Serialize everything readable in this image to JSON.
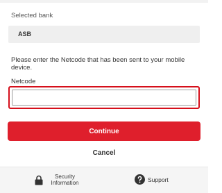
{
  "selected_bank": {
    "label": "Selected bank",
    "value": "ASB"
  },
  "instructions": "Please enter the Netcode that has been sent to your mobile device.",
  "netcode": {
    "label": "Netcode",
    "value": "",
    "placeholder": ""
  },
  "actions": {
    "continue_label": "Continue",
    "cancel_label": "Cancel"
  },
  "footer": {
    "security_label": "Security Information",
    "security_icon": "lock-icon",
    "support_label": "Support",
    "support_icon": "question-circle-icon"
  },
  "colors": {
    "accent": "#df1f2c",
    "field_focus_border": "#d50f1b",
    "bank_box_bg": "#efefef",
    "footer_bg": "#f5f5f5"
  }
}
